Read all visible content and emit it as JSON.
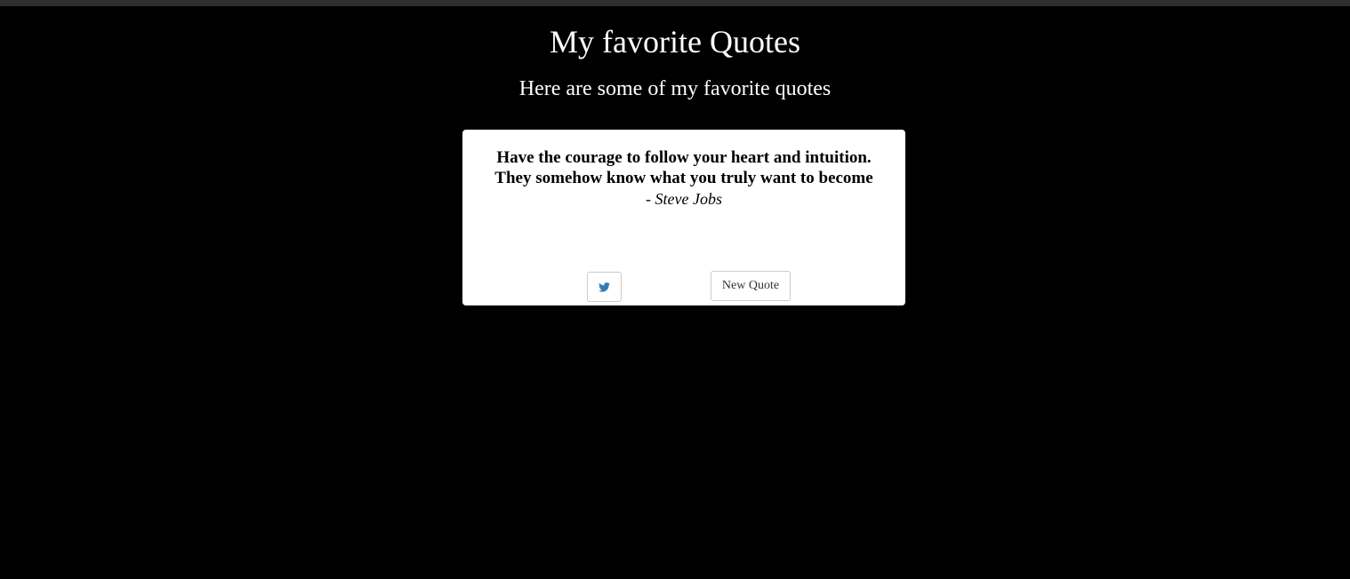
{
  "header": {
    "title": "My favorite Quotes",
    "subtitle": "Here are some of my favorite quotes"
  },
  "quote": {
    "lines": [
      "Have the courage to follow your heart and intuition.",
      "They somehow know what you truly want to become"
    ],
    "author": "- Steve Jobs"
  },
  "actions": {
    "tweet_icon": "twitter-icon",
    "new_quote_label": "New Quote"
  },
  "colors": {
    "background": "#000000",
    "card": "#ffffff",
    "twitter_blue": "#337ab7"
  }
}
